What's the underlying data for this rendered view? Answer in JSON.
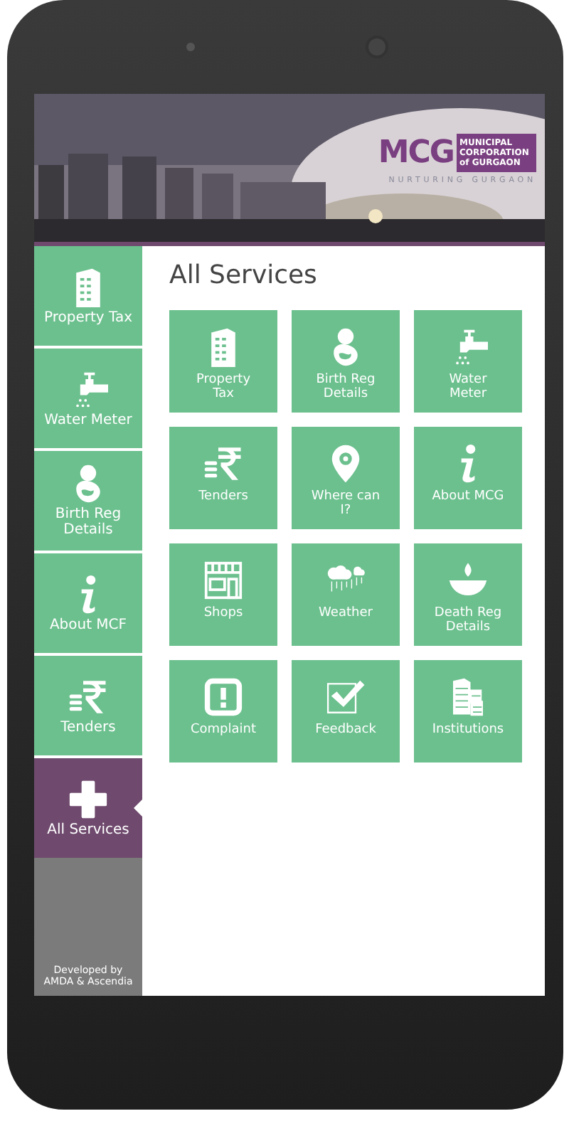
{
  "header": {
    "logo_mark": "MCG",
    "logo_text": "MUNICIPAL CORPORATION of GURGAON",
    "tagline": "NURTURING GURGAON"
  },
  "sidebar": {
    "items": [
      {
        "label": "Property Tax",
        "kind": "building",
        "selected": false
      },
      {
        "label": "Water Meter",
        "kind": "tap",
        "selected": false
      },
      {
        "label": "Birth Reg Details",
        "kind": "mother",
        "selected": false
      },
      {
        "label": "About MCF",
        "kind": "info",
        "selected": false
      },
      {
        "label": "Tenders",
        "kind": "rupee",
        "selected": false
      },
      {
        "label": "All Services",
        "kind": "plus",
        "selected": true
      }
    ],
    "footer": "Developed by AMDA & Ascendia"
  },
  "main": {
    "title": "All Services",
    "tiles": [
      {
        "label": "Property Tax",
        "kind": "building"
      },
      {
        "label": "Birth Reg Details",
        "kind": "mother"
      },
      {
        "label": "Water Meter",
        "kind": "tap"
      },
      {
        "label": "Tenders",
        "kind": "rupee"
      },
      {
        "label": "Where can I?",
        "kind": "pin"
      },
      {
        "label": "About MCG",
        "kind": "info"
      },
      {
        "label": "Shops",
        "kind": "shop"
      },
      {
        "label": "Weather",
        "kind": "rain"
      },
      {
        "label": "Death Reg Details",
        "kind": "lamp"
      },
      {
        "label": "Complaint",
        "kind": "alert"
      },
      {
        "label": "Feedback",
        "kind": "check"
      },
      {
        "label": "Institutions",
        "kind": "buildings"
      }
    ]
  }
}
